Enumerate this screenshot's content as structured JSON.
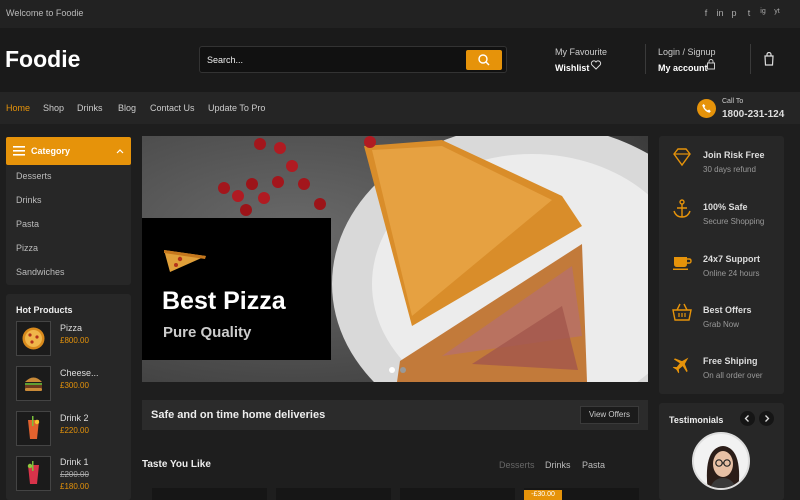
{
  "topbar": {
    "welcome": "Welcome to Foodie",
    "social": [
      "f",
      "in",
      "p",
      "t",
      "ig",
      "yt"
    ]
  },
  "header": {
    "logo": "Foodie",
    "search_placeholder": "Search...",
    "favourite_label": "My Favourite",
    "wishlist_label": "Wishlist",
    "login_label": "Login / Signup",
    "account_label": "My account"
  },
  "nav": {
    "items": [
      "Home",
      "Shop",
      "Drinks",
      "Blog",
      "Contact Us",
      "Update To Pro"
    ],
    "call_label": "Call To",
    "phone": "1800-231-124"
  },
  "category": {
    "title": "Category",
    "items": [
      "Desserts",
      "Drinks",
      "Pasta",
      "Pizza",
      "Sandwiches"
    ]
  },
  "hot_products": {
    "title": "Hot Products",
    "items": [
      {
        "name": "Pizza",
        "price": "£800.00",
        "old_price": ""
      },
      {
        "name": "Cheese...",
        "price": "£300.00",
        "old_price": ""
      },
      {
        "name": "Drink 2",
        "price": "£220.00",
        "old_price": ""
      },
      {
        "name": "Drink 1",
        "price": "£180.00",
        "old_price": "£200.00"
      }
    ]
  },
  "hero": {
    "title": "Best Pizza",
    "subtitle": "Pure Quality",
    "slide_count": 2,
    "active_slide": 1
  },
  "delivery": {
    "text": "Safe and on time home deliveries",
    "button": "View Offers"
  },
  "taste": {
    "title": "Taste You Like",
    "tabs": [
      "Desserts",
      "Drinks",
      "Pasta"
    ],
    "badge": "-£30.00"
  },
  "features": [
    {
      "title": "Join Risk Free",
      "sub": "30 days refund",
      "icon": "diamond-icon"
    },
    {
      "title": "100% Safe",
      "sub": "Secure Shopping",
      "icon": "anchor-icon"
    },
    {
      "title": "24x7 Support",
      "sub": "Online 24 hours",
      "icon": "cup-icon"
    },
    {
      "title": "Best Offers",
      "sub": "Grab Now",
      "icon": "basket-icon"
    },
    {
      "title": "Free Shiping",
      "sub": "On all order over",
      "icon": "plane-icon"
    }
  ],
  "testimonials": {
    "title": "Testimonials"
  },
  "colors": {
    "accent": "#e6930a",
    "background": "#1e1e1e",
    "panel": "#272727"
  }
}
